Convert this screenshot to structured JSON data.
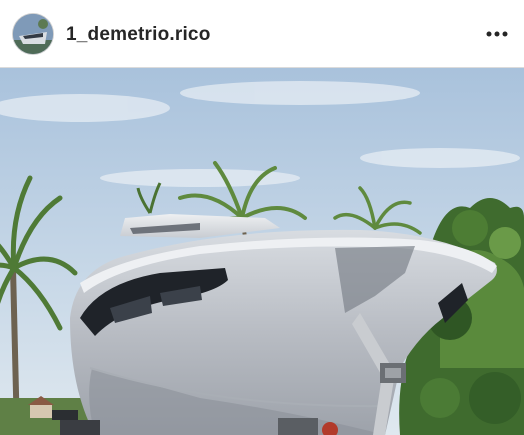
{
  "post": {
    "username": "1_demetrio.rico",
    "more_icon": "more-horizontal-icon",
    "avatar_icon": "boat-avatar-icon"
  },
  "photo": {
    "subject": "yacht-hull-on-trailer-photo"
  },
  "colors": {
    "text": "#262626",
    "border": "#dbdbdb",
    "sky": "#b9cde0",
    "hull": "#c5c9cf"
  }
}
